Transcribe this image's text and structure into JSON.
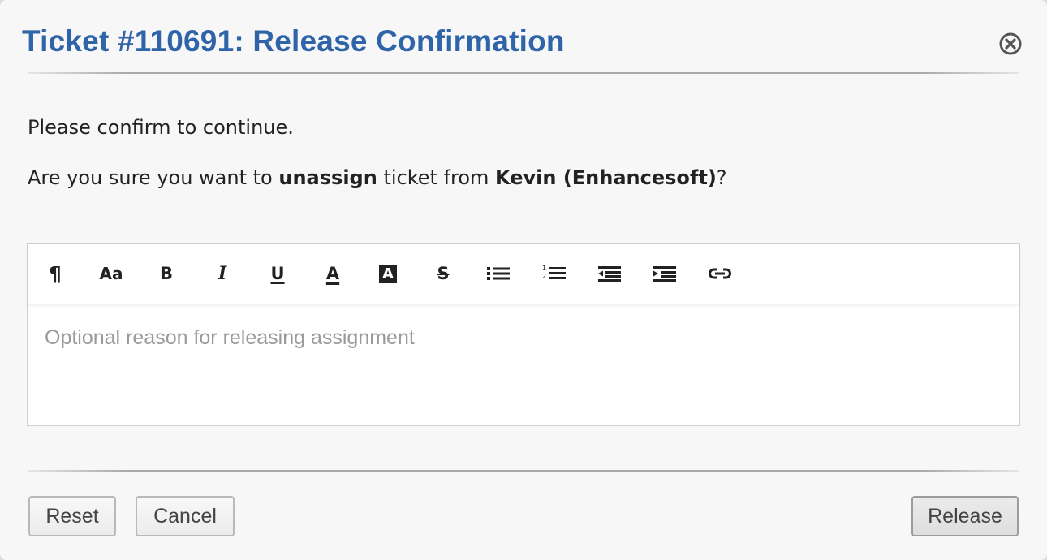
{
  "dialog": {
    "title": "Ticket #110691: Release Confirmation",
    "close_icon": "close-circle-icon"
  },
  "message": {
    "line1": "Please confirm to continue.",
    "line2_prefix": "Are you sure you want to ",
    "line2_action": "unassign",
    "line2_middle": " ticket from ",
    "line2_user": "Kevin (Enhancesoft)",
    "line2_suffix": "?"
  },
  "editor": {
    "placeholder": "Optional reason for releasing assignment",
    "value": "",
    "toolbar": [
      {
        "name": "paragraph-icon",
        "label": "¶"
      },
      {
        "name": "font-size-icon",
        "label": "Aa"
      },
      {
        "name": "bold-icon",
        "label": "B"
      },
      {
        "name": "italic-icon",
        "label": "I"
      },
      {
        "name": "underline-icon",
        "label": "U"
      },
      {
        "name": "font-color-icon",
        "label": "A"
      },
      {
        "name": "highlight-icon",
        "label": "A"
      },
      {
        "name": "strikethrough-icon",
        "label": "S"
      },
      {
        "name": "unordered-list-icon"
      },
      {
        "name": "ordered-list-icon"
      },
      {
        "name": "outdent-icon"
      },
      {
        "name": "indent-icon"
      },
      {
        "name": "link-icon"
      }
    ]
  },
  "buttons": {
    "reset": "Reset",
    "cancel": "Cancel",
    "release": "Release"
  },
  "colors": {
    "title": "#2f64a8",
    "background": "#f7f7f7"
  }
}
